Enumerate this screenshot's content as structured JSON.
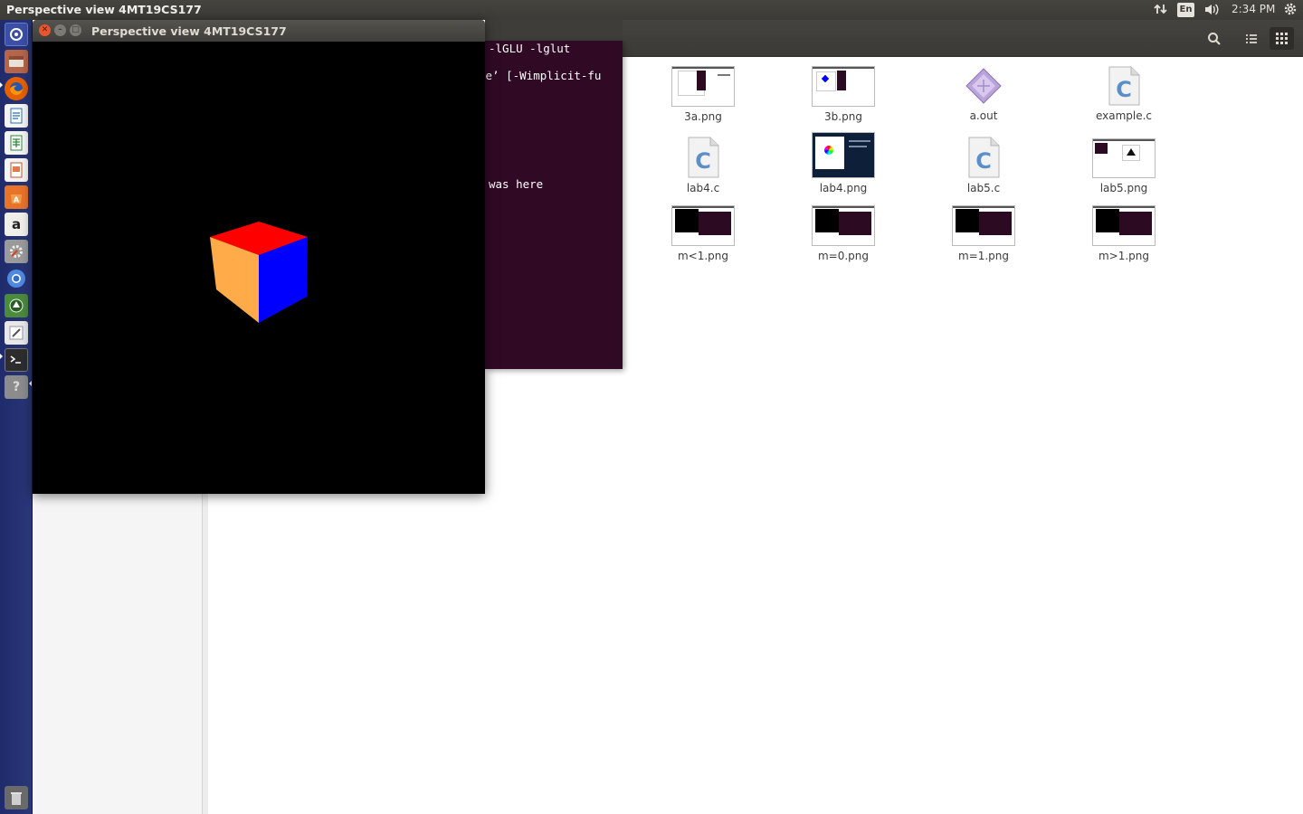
{
  "top_panel": {
    "title": "Perspective view 4MT19CS177",
    "keyboard_layout": "En",
    "time": "2:34 PM"
  },
  "launcher": {
    "items": [
      {
        "icon": "dash-home-icon",
        "color": "#3b4fa6"
      },
      {
        "icon": "files-icon",
        "color": "#a0522d"
      },
      {
        "icon": "firefox-icon",
        "color": "#e66000"
      },
      {
        "icon": "writer-icon",
        "color": "#2a6fb0"
      },
      {
        "icon": "calc-icon",
        "color": "#2f8a3a"
      },
      {
        "icon": "impress-icon",
        "color": "#c8532a"
      },
      {
        "icon": "software-center-icon",
        "color": "#e8742a"
      },
      {
        "icon": "amazon-icon",
        "color": "#f0efea"
      },
      {
        "icon": "system-settings-icon",
        "color": "#8a8a8a"
      },
      {
        "icon": "chromium-icon",
        "color": "#3f7fd6"
      },
      {
        "icon": "software-updater-icon",
        "color": "#4c8a3c"
      },
      {
        "icon": "text-editor-icon",
        "color": "#e8e8e8"
      },
      {
        "icon": "terminal-icon",
        "color": "#2d2d2d"
      },
      {
        "icon": "help-icon",
        "color": "#8c8c8c"
      }
    ],
    "trash_icon": "trash-icon"
  },
  "gl_window": {
    "title": "Perspective view 4MT19CS177",
    "cube_colors": {
      "top": "#ff0000",
      "left": "#ffab4a",
      "right": "#0000ff"
    }
  },
  "terminal": {
    "lines": [
      "-lGLU -lglut",
      "pe’ [-Wimplicit-fu",
      "was here"
    ]
  },
  "file_manager": {
    "files": [
      {
        "name": "3a.png",
        "kind": "image-icon"
      },
      {
        "name": "3b.png",
        "kind": "image-icon"
      },
      {
        "name": "a.out",
        "kind": "executable-icon"
      },
      {
        "name": "example.c",
        "kind": "c-source-icon"
      },
      {
        "name": "lab4.c",
        "kind": "c-source-icon"
      },
      {
        "name": "lab4.png",
        "kind": "image-icon"
      },
      {
        "name": "lab5.c",
        "kind": "c-source-icon"
      },
      {
        "name": "lab5.png",
        "kind": "image-icon"
      },
      {
        "name": "m<1.png",
        "kind": "image-icon"
      },
      {
        "name": "m=0.png",
        "kind": "image-icon"
      },
      {
        "name": "m=1.png",
        "kind": "image-icon"
      },
      {
        "name": "m>1.png",
        "kind": "image-icon"
      }
    ]
  }
}
